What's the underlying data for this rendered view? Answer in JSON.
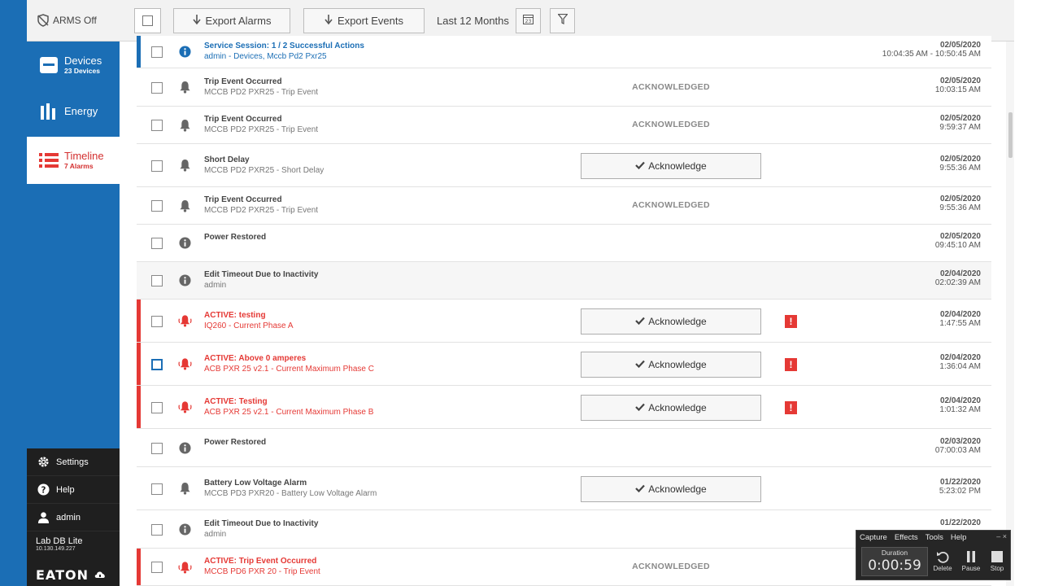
{
  "sidebar": {
    "arms": "ARMS Off",
    "nav": [
      {
        "label": "Devices",
        "sub": "23 Devices",
        "icon": "devices-icon"
      },
      {
        "label": "Energy",
        "sub": "",
        "icon": "energy-bars-icon"
      },
      {
        "label": "Timeline",
        "sub": "7 Alarms",
        "icon": "timeline-list-icon"
      }
    ],
    "bottom": [
      {
        "label": "Settings",
        "icon": "gear-icon"
      },
      {
        "label": "Help",
        "icon": "help-icon"
      },
      {
        "label": "admin",
        "icon": "user-icon"
      }
    ],
    "db_name": "Lab DB Lite",
    "db_ip": "10.130.149.227",
    "logo": "EATON"
  },
  "toolbar": {
    "export_alarms": "Export Alarms",
    "export_events": "Export Events",
    "range": "Last 12 Months"
  },
  "colors": {
    "accent": "#1b6eb5",
    "alarm": "#e53935",
    "sidebar_bottom": "#1f1f1f"
  },
  "rows": [
    {
      "title": "Service Session: 1 / 2 Successful Actions",
      "sub": "admin - Devices, Mccb Pd2 Pxr25",
      "status": "",
      "ack": "",
      "date": "02/05/2020",
      "time": "10:04:35 AM - 10:50:45 AM"
    },
    {
      "title": "Trip Event Occurred",
      "sub": "MCCB PD2 PXR25 - Trip Event",
      "status": "ACKNOWLEDGED",
      "ack": "",
      "date": "02/05/2020",
      "time": "10:03:15 AM"
    },
    {
      "title": "Trip Event Occurred",
      "sub": "MCCB PD2 PXR25 - Trip Event",
      "status": "ACKNOWLEDGED",
      "ack": "",
      "date": "02/05/2020",
      "time": "9:59:37 AM"
    },
    {
      "title": "Short Delay",
      "sub": "MCCB PD2 PXR25 - Short Delay",
      "status": "",
      "ack": "Acknowledge",
      "date": "02/05/2020",
      "time": "9:55:36 AM"
    },
    {
      "title": "Trip Event Occurred",
      "sub": "MCCB PD2 PXR25 - Trip Event",
      "status": "ACKNOWLEDGED",
      "ack": "",
      "date": "02/05/2020",
      "time": "9:55:36 AM"
    },
    {
      "title": "Power Restored",
      "sub": "",
      "status": "",
      "ack": "",
      "date": "02/05/2020",
      "time": "09:45:10 AM"
    },
    {
      "title": "Edit Timeout Due to Inactivity",
      "sub": "admin",
      "status": "",
      "ack": "",
      "date": "02/04/2020",
      "time": "02:02:39 AM"
    },
    {
      "title": "ACTIVE: testing",
      "sub": "IQ260 - Current Phase A",
      "status": "",
      "ack": "Acknowledge",
      "date": "02/04/2020",
      "time": "1:47:55 AM"
    },
    {
      "title": "ACTIVE: Above 0 amperes",
      "sub": "ACB PXR 25 v2.1 - Current Maximum Phase C",
      "status": "",
      "ack": "Acknowledge",
      "date": "02/04/2020",
      "time": "1:36:04 AM"
    },
    {
      "title": "ACTIVE: Testing",
      "sub": "ACB PXR 25 v2.1 - Current Maximum Phase B",
      "status": "",
      "ack": "Acknowledge",
      "date": "02/04/2020",
      "time": "1:01:32 AM"
    },
    {
      "title": "Power Restored",
      "sub": "",
      "status": "",
      "ack": "",
      "date": "02/03/2020",
      "time": "07:00:03 AM"
    },
    {
      "title": "Battery Low Voltage Alarm",
      "sub": "MCCB PD3 PXR20 - Battery Low Voltage Alarm",
      "status": "",
      "ack": "Acknowledge",
      "date": "01/22/2020",
      "time": "5:23:02 PM"
    },
    {
      "title": "Edit Timeout Due to Inactivity",
      "sub": "admin",
      "status": "",
      "ack": "",
      "date": "01/22/2020",
      "time": ""
    },
    {
      "title": "ACTIVE: Trip Event Occurred",
      "sub": "MCCB PD6 PXR 20 - Trip Event",
      "status": "ACKNOWLEDGED",
      "ack": "",
      "date": "",
      "time": ""
    }
  ],
  "recorder": {
    "menu": [
      "Capture",
      "Effects",
      "Tools",
      "Help"
    ],
    "duration_label": "Duration",
    "duration": "0:00:59",
    "buttons": [
      "Delete",
      "Pause",
      "Stop"
    ]
  }
}
